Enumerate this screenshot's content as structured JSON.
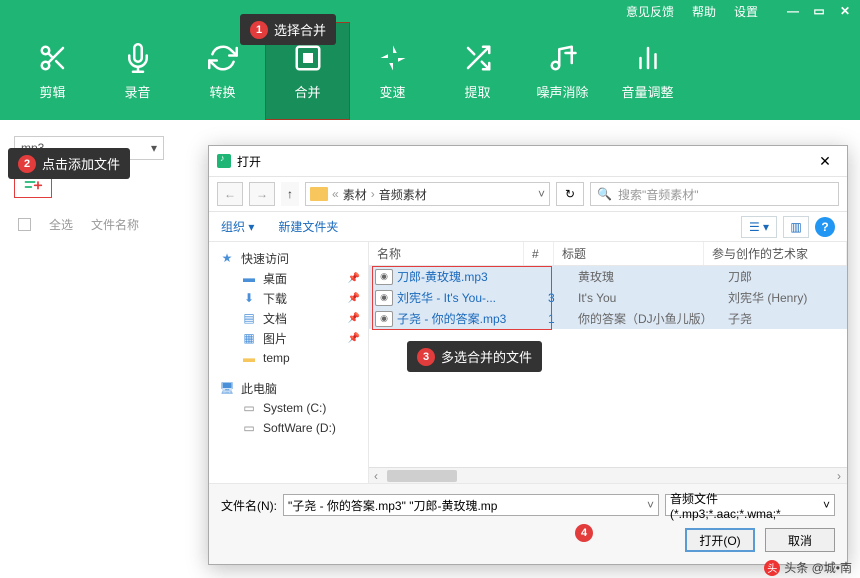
{
  "header": {
    "feedback": "意见反馈",
    "help": "帮助",
    "settings": "设置"
  },
  "tools": {
    "edit": "剪辑",
    "record": "录音",
    "convert": "转换",
    "merge": "合并",
    "speed": "变速",
    "extract": "提取",
    "noise": "噪声消除",
    "volume": "音量调整"
  },
  "callout1": {
    "num": "1",
    "text": "选择合并"
  },
  "callout2": {
    "num": "2",
    "text": "点击添加文件"
  },
  "callout3": {
    "num": "3",
    "text": "多选合并的文件"
  },
  "callout4": {
    "num": "4"
  },
  "format": {
    "value": "mp3",
    "arrow": "▾"
  },
  "list": {
    "select_all": "全选",
    "filename": "文件名称"
  },
  "dialog": {
    "title": "打开",
    "breadcrumb": {
      "seg1": "素材",
      "seg2": "音频素材"
    },
    "search_placeholder": "搜索\"音频素材\"",
    "organize": "组织",
    "new_folder": "新建文件夹",
    "columns": {
      "name": "名称",
      "num": "#",
      "title": "标题",
      "artist": "参与创作的艺术家"
    },
    "tree": {
      "quick": "快速访问",
      "desktop": "桌面",
      "downloads": "下载",
      "documents": "文档",
      "pictures": "图片",
      "temp": "temp",
      "thispc": "此电脑",
      "system": "System (C:)",
      "software": "SoftWare (D:)"
    },
    "files": [
      {
        "name": "刀郎-黄玫瑰.mp3",
        "num": "",
        "title": "黄玫瑰",
        "artist": "刀郎"
      },
      {
        "name": "刘宪华 - It's You-...",
        "num": "3",
        "title": "It's You",
        "artist": "刘宪华 (Henry)"
      },
      {
        "name": "子尧 - 你的答案.mp3",
        "num": "1",
        "title": "你的答案（DJ小鱼儿版）",
        "artist": "子尧"
      }
    ],
    "filename_label": "文件名(N):",
    "filename_value": "\"子尧 - 你的答案.mp3\" \"刀郎-黄玫瑰.mp",
    "filetype": "音频文件(*.mp3;*.aac;*.wma;*",
    "open_btn": "打开(O)",
    "cancel_btn": "取消"
  },
  "watermark": "头条 @城•南"
}
